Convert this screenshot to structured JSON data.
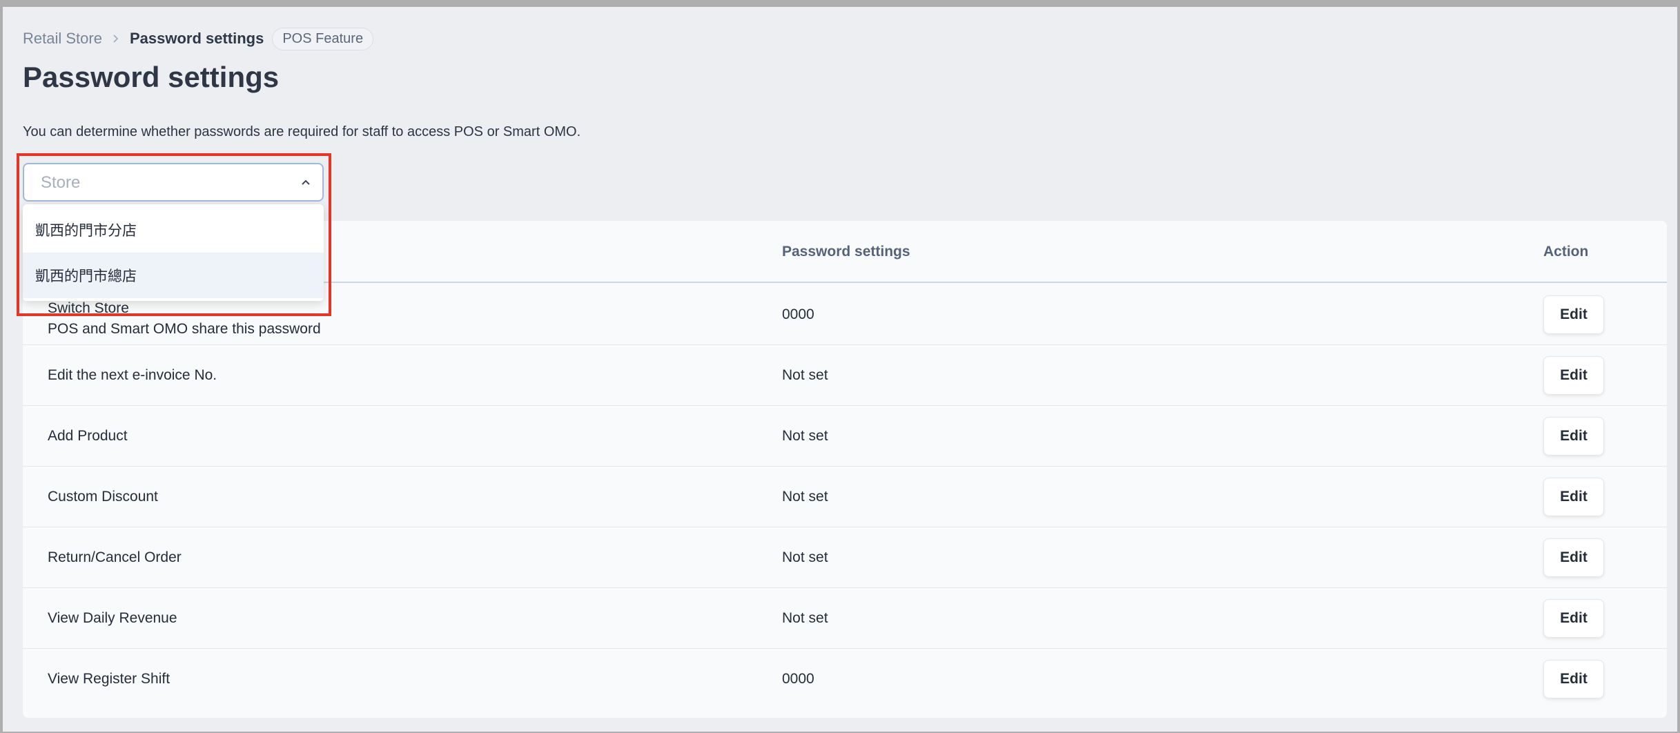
{
  "breadcrumb": {
    "root": "Retail Store",
    "current": "Password settings",
    "tag": "POS Feature"
  },
  "page": {
    "title": "Password settings",
    "description": "You can determine whether passwords are required for staff to access POS or Smart OMO."
  },
  "store_select": {
    "placeholder": "Store",
    "value": "",
    "expanded": true,
    "options": [
      "凱西的門市分店",
      "凱西的門市總店"
    ],
    "hovered_option": "凱西的門市總店"
  },
  "table": {
    "columns": {
      "feature": "",
      "password": "Password settings",
      "action": "Action"
    },
    "edit_label": "Edit",
    "rows": [
      {
        "name": "Switch Store",
        "sub": "POS and Smart OMO share this password",
        "password": "0000"
      },
      {
        "name": "Edit the next e-invoice No.",
        "password": "Not set"
      },
      {
        "name": "Add Product",
        "password": "Not set"
      },
      {
        "name": "Custom Discount",
        "password": "Not set"
      },
      {
        "name": "Return/Cancel Order",
        "password": "Not set"
      },
      {
        "name": "View Daily Revenue",
        "password": "Not set"
      },
      {
        "name": "View Register Shift",
        "password": "0000"
      }
    ]
  },
  "colors": {
    "highlight": "#e53527",
    "title": "#2f3747",
    "background": "#edeef1"
  }
}
